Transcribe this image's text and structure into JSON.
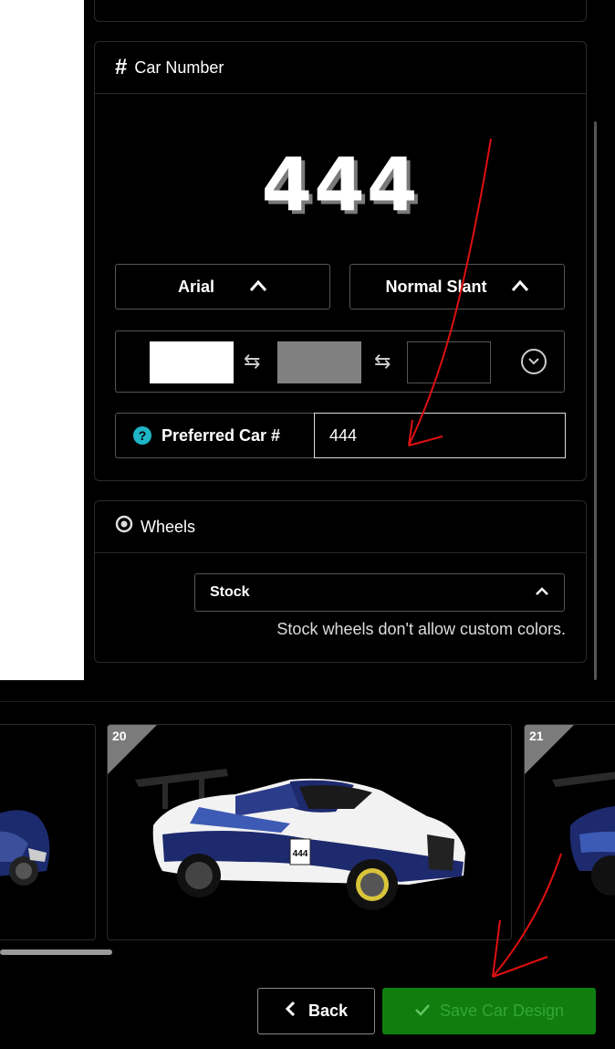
{
  "car_number": {
    "header": {
      "icon": "#",
      "title": "Car Number"
    },
    "preview_number": "444",
    "font_select": {
      "value": "Arial"
    },
    "slant_select": {
      "value": "Normal Slant"
    },
    "colors": [
      "#ffffff",
      "#808080",
      "#000000"
    ],
    "preferred": {
      "label": "Preferred Car #",
      "value": "444"
    }
  },
  "wheels": {
    "header": {
      "title": "Wheels"
    },
    "select_value": "Stock",
    "note": "Stock wheels don't allow custom colors."
  },
  "gallery": {
    "cards": [
      {
        "number": ""
      },
      {
        "number": "20"
      },
      {
        "number": "21"
      }
    ]
  },
  "footer": {
    "back_label": "Back",
    "save_label": "Save Car Design"
  }
}
